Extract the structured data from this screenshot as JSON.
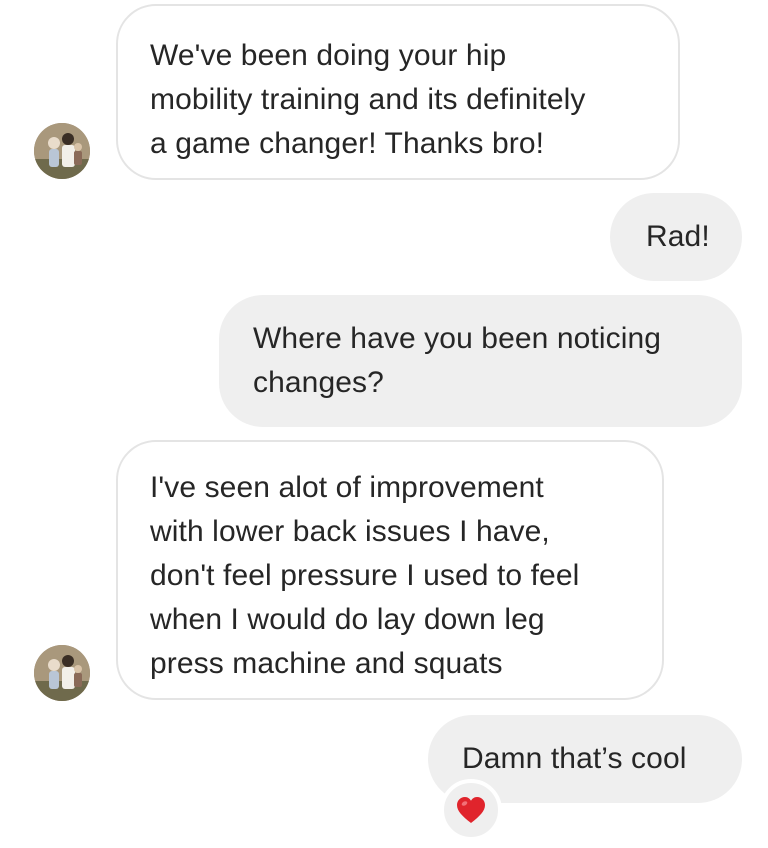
{
  "messages": [
    {
      "direction": "incoming",
      "lines": [
        "We've been doing your hip",
        "mobility training and its definitely",
        "a game changer! Thanks bro!"
      ]
    },
    {
      "direction": "outgoing",
      "lines": [
        "Rad!"
      ]
    },
    {
      "direction": "outgoing",
      "lines": [
        "Where have you been noticing",
        "changes?"
      ]
    },
    {
      "direction": "incoming",
      "lines": [
        "I've seen alot of improvement",
        "with lower back issues I have,",
        "don't feel pressure I used to feel",
        "when I would do lay down leg",
        "press machine and squats"
      ]
    },
    {
      "direction": "outgoing",
      "lines": [
        "Damn that’s cool"
      ],
      "reaction": "heart-emoji"
    }
  ],
  "colors": {
    "incoming_border": "#e4e4e4",
    "outgoing_bg": "#efefef",
    "text": "#262626",
    "heart": "#e0242c"
  },
  "icons": {
    "avatar": "sender-avatar",
    "reaction": "red-heart-icon"
  }
}
